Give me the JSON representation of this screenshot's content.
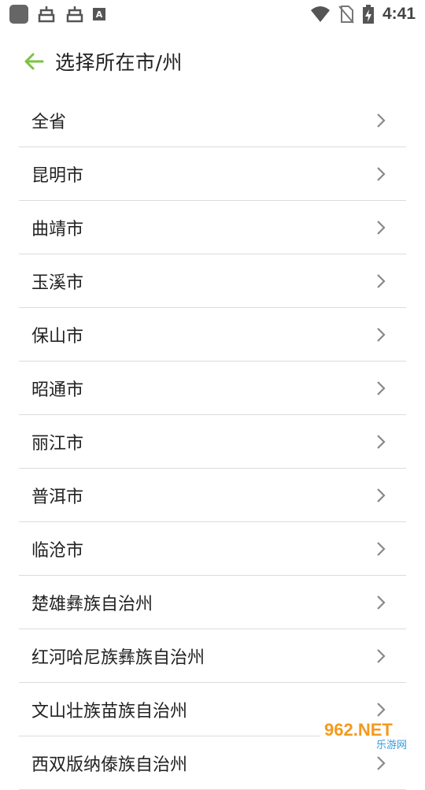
{
  "status_bar": {
    "time": "4:41",
    "app_icon_text": "A",
    "icons": [
      "app-square-icon",
      "bug-icon",
      "bug-icon",
      "a-notification-icon",
      "wifi-icon",
      "no-sim-icon",
      "battery-charging-icon"
    ]
  },
  "header": {
    "title": "选择所在市/州",
    "back_icon": "arrow-left-icon",
    "accent": "#7cc242"
  },
  "cities": [
    {
      "label": "全省"
    },
    {
      "label": "昆明市"
    },
    {
      "label": "曲靖市"
    },
    {
      "label": "玉溪市"
    },
    {
      "label": "保山市"
    },
    {
      "label": "昭通市"
    },
    {
      "label": "丽江市"
    },
    {
      "label": "普洱市"
    },
    {
      "label": "临沧市"
    },
    {
      "label": "楚雄彝族自治州"
    },
    {
      "label": "红河哈尼族彝族自治州"
    },
    {
      "label": "文山壮族苗族自治州"
    },
    {
      "label": "西双版纳傣族自治州"
    }
  ],
  "watermark": {
    "top_text": "962.NET",
    "bottom_text": "乐游网"
  }
}
